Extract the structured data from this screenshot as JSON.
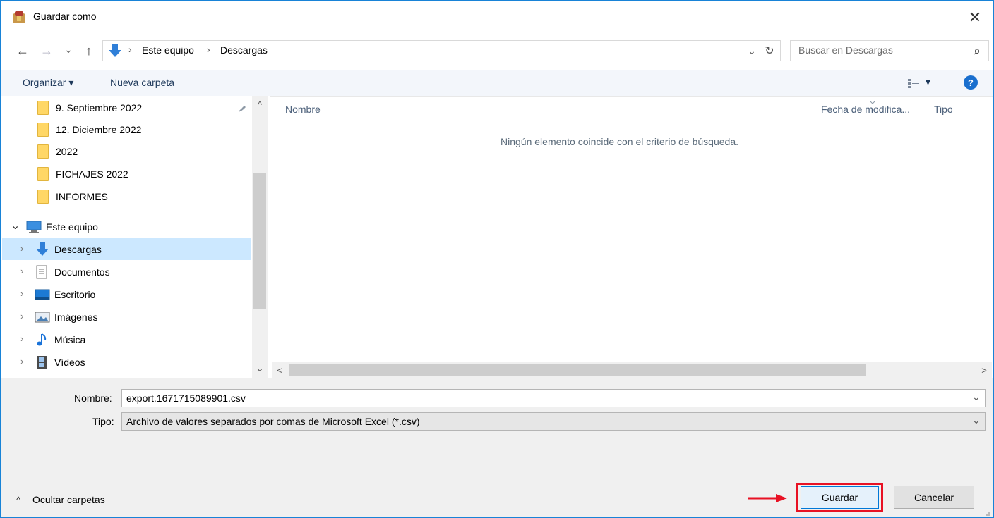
{
  "window": {
    "title": "Guardar como",
    "close_glyph": "✕"
  },
  "nav": {
    "back_glyph": "←",
    "forward_glyph": "→",
    "recent_glyph": "⌄",
    "up_glyph": "↑",
    "breadcrumb": [
      "Este equipo",
      "Descargas"
    ],
    "breadcrumb_sep": "›",
    "dropdown_glyph": "⌄",
    "refresh_glyph": "↻",
    "search_placeholder": "Buscar en Descargas",
    "search_icon": "⌕"
  },
  "toolbar": {
    "organize_label": "Organizar",
    "organize_arrow": "▾",
    "new_folder_label": "Nueva carpeta",
    "view_arrow": "▾",
    "help_glyph": "?"
  },
  "tree": {
    "quick_access": [
      {
        "label": "9. Septiembre 2022",
        "pinned": true
      },
      {
        "label": "12. Diciembre 2022"
      },
      {
        "label": "2022"
      },
      {
        "label": "FICHAJES 2022"
      },
      {
        "label": "INFORMES"
      }
    ],
    "pin_glyph": "📌",
    "computer": {
      "label": "Este equipo",
      "chev": "⌄"
    },
    "computer_children": [
      {
        "label": "Descargas",
        "icon": "download-icon",
        "selected": true
      },
      {
        "label": "Documentos",
        "icon": "documents-icon"
      },
      {
        "label": "Escritorio",
        "icon": "desktop-icon"
      },
      {
        "label": "Imágenes",
        "icon": "pictures-icon"
      },
      {
        "label": "Música",
        "icon": "music-icon"
      },
      {
        "label": "Vídeos",
        "icon": "videos-icon"
      }
    ],
    "child_chev": "›",
    "scroll_up": "^",
    "scroll_down": "⌄"
  },
  "list": {
    "columns": [
      "Nombre",
      "Fecha de modifica...",
      "Tipo"
    ],
    "empty_message": "Ningún elemento coincide con el criterio de búsqueda.",
    "scroll_left": "<",
    "scroll_right": ">"
  },
  "form": {
    "name_label": "Nombre:",
    "name_value": "export.1671715089901.csv",
    "type_label": "Tipo:",
    "type_value": "Archivo de valores separados por comas de Microsoft Excel (*.csv)",
    "dropdown_glyph": "⌄"
  },
  "footer": {
    "hide_folders_glyph": "^",
    "hide_folders_label": "Ocultar carpetas",
    "save_label": "Guardar",
    "cancel_label": "Cancelar"
  },
  "colors": {
    "accent": "#1883d7",
    "highlight": "#e81123",
    "selected_bg": "#cce8ff"
  }
}
